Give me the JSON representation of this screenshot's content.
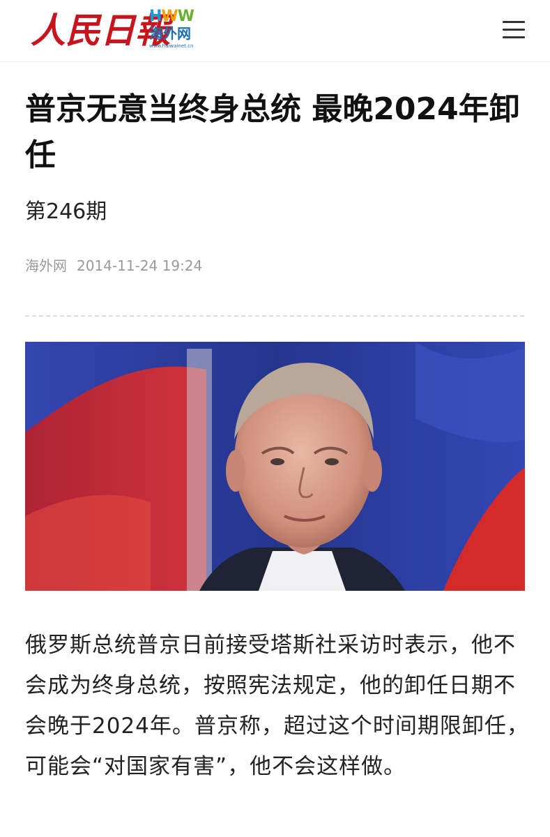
{
  "header": {
    "masthead": "人民日報",
    "partner_logo_letters": [
      "H",
      "W",
      "W"
    ],
    "partner_logo_name": "海外网",
    "partner_logo_url": "www.haiwainet.cn",
    "menu_icon": "hamburger-menu-icon"
  },
  "article": {
    "title": "普京无意当终身总统 最晚2024年卸任",
    "issue": "第246期",
    "source": "海外网",
    "date": "2014-11-24 19:24",
    "image_icon": "photo",
    "body": "俄罗斯总统普京日前接受塔斯社采访时表示，他不会成为终身总统，按照宪法规定，他的卸任日期不会晚于2024年。普京称，超过这个时间期限卸任，可能会“对国家有害”，他不会这样做。"
  },
  "colors": {
    "masthead": "#c8151d",
    "logo_blue": "#1a9bd7",
    "logo_orange": "#f4a300",
    "logo_green": "#6ab02f",
    "meta_gray": "#9a9a9a",
    "flag_blue": "#2d3f9c",
    "flag_red": "#d42a2a"
  }
}
